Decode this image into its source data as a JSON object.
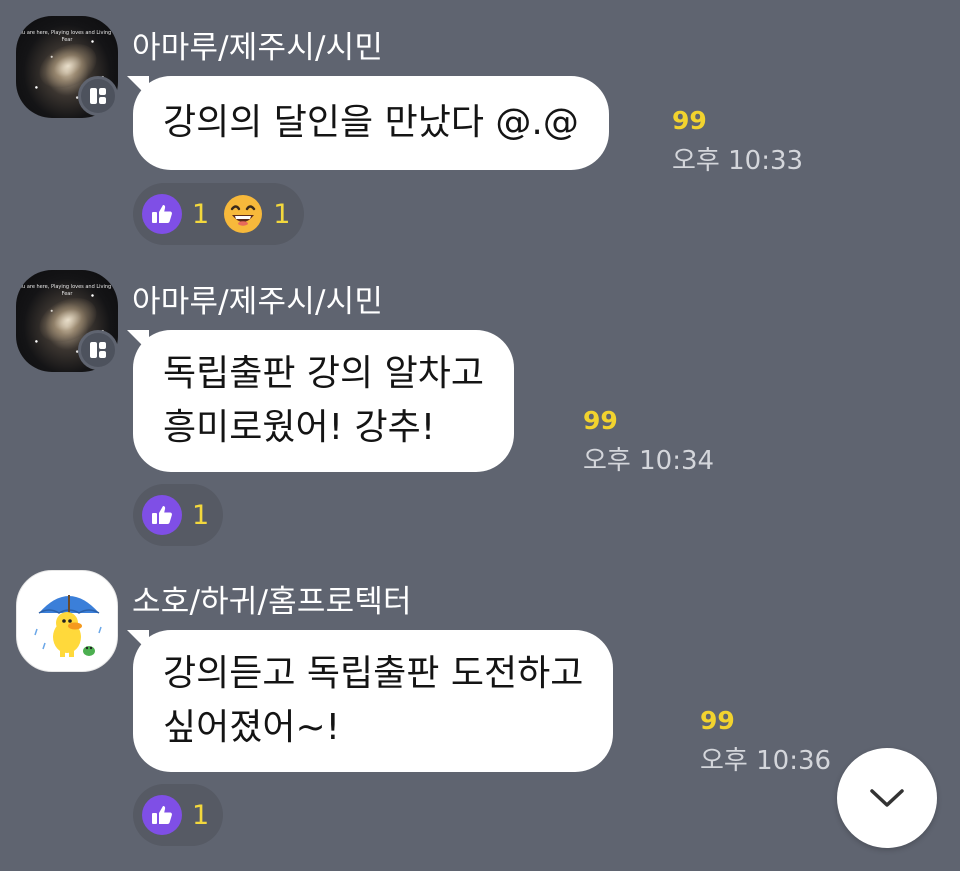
{
  "colors": {
    "background": "#5f6470",
    "bubble": "#ffffff",
    "unread": "#f2d32e",
    "reaction_count": "#f3d83d",
    "like_icon_bg": "#7f4fe6"
  },
  "avatar_caption": "You are here, Playing loves and Living in Fear",
  "messages": [
    {
      "sender": "아마루/제주시/시민",
      "lines": [
        "강의의 달인을 만났다 @.@"
      ],
      "unread": "99",
      "time": "오후 10:33",
      "reactions": [
        {
          "icon": "thumbs-up-icon",
          "count": "1"
        },
        {
          "icon": "laughing-face-icon",
          "count": "1"
        }
      ]
    },
    {
      "sender": "아마루/제주시/시민",
      "lines": [
        "독립출판 강의 알차고",
        "흥미로웠어! 강추!"
      ],
      "unread": "99",
      "time": "오후 10:34",
      "reactions": [
        {
          "icon": "thumbs-up-icon",
          "count": "1"
        }
      ]
    },
    {
      "sender": "소호/하귀/홈프로텍터",
      "lines": [
        "강의듣고 독립출판 도전하고",
        "싶어졌어~!"
      ],
      "unread": "99",
      "time": "오후 10:36",
      "reactions": [
        {
          "icon": "thumbs-up-icon",
          "count": "1"
        }
      ]
    }
  ]
}
